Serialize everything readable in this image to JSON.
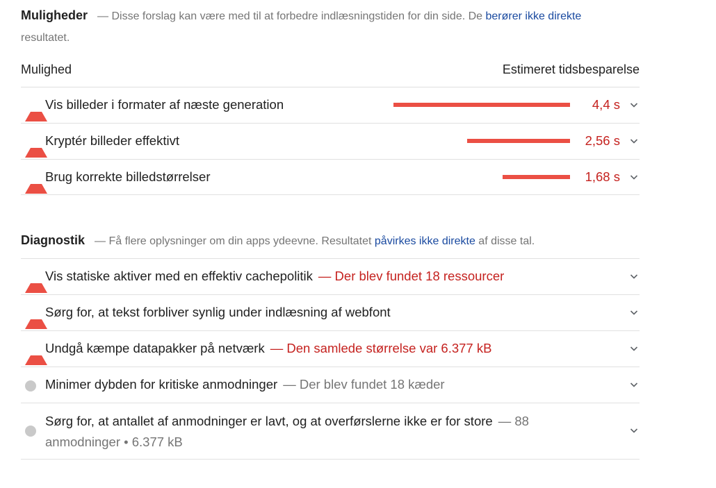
{
  "opportunities": {
    "title": "Muligheder",
    "desc_before_link": "— Disse forslag kan være med til at forbedre indlæsningstiden for din side. De ",
    "link": "berører ikke direkte",
    "desc_after_link": " resultatet.",
    "col_left": "Mulighed",
    "col_right": "Estimeret tidsbesparelse",
    "items": [
      {
        "label": "Vis billeder i formater af næste generation",
        "value": "4,4 s",
        "savings_s": 4.4
      },
      {
        "label": "Kryptér billeder effektivt",
        "value": "2,56 s",
        "savings_s": 2.56
      },
      {
        "label": "Brug korrekte billedstørrelser",
        "value": "1,68 s",
        "savings_s": 1.68
      }
    ]
  },
  "diagnostics": {
    "title": "Diagnostik",
    "desc_before_link": "— Få flere oplysninger om din apps ydeevne. Resultatet ",
    "link": "påvirkes ikke direkte",
    "desc_after_link": " af disse tal.",
    "items": [
      {
        "label": "Vis statiske aktiver med en effektiv cachepolitik",
        "sub": "— Der blev fundet 18 ressourcer"
      },
      {
        "label": "Sørg for, at tekst forbliver synlig under indlæsning af webfont",
        "sub": ""
      },
      {
        "label": "Undgå kæmpe datapakker på netværk",
        "sub": "— Den samlede størrelse var 6.377 kB"
      },
      {
        "label": "Minimer dybden for kritiske anmodninger",
        "sub": "— Der blev fundet 18 kæder"
      },
      {
        "label": "Sørg for, at antallet af anmodninger er lavt, og at overførslerne ikke er for store",
        "sub": "— 88 anmodninger • 6.377 kB"
      }
    ]
  },
  "colors": {
    "fail": "#eb4f44",
    "fail_text": "#c5221f",
    "info": "#c9c9c9",
    "link": "#1a4aa0"
  },
  "icons": {
    "fail": "red-triangle-icon",
    "info": "grey-circle-icon",
    "expand": "chevron-down-icon"
  }
}
